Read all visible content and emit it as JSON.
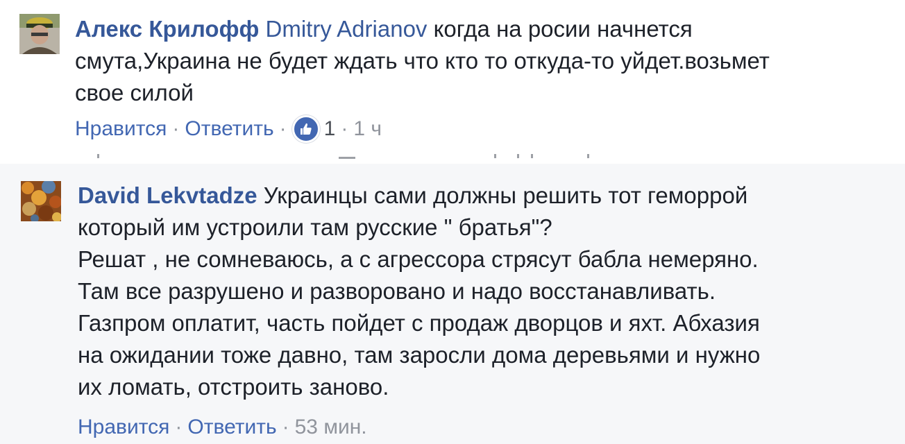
{
  "comments": [
    {
      "author": "Алекс Крилофф",
      "mention": "Dmitry Adrianov",
      "lines": [
        " когда на росии начнется",
        "смута,Украина не будет ждать что кто то откуда-то уйдет.возьмет",
        "свое силой"
      ],
      "like_label": "Нравится",
      "reply_label": "Ответить",
      "separator": "·",
      "reaction_count": "1",
      "timestamp": "1 ч",
      "reaction_icon": "thumbs-up-icon"
    },
    {
      "author": "David Lekvtadze",
      "lines": [
        " Украинцы сами должны решить тот геморрой",
        "который им устроили там русские \" братья\"?",
        "Решат , не сомневаюсь, а с агрессора стрясут бабла немеряно.",
        "Там все разрушено и разворовано и надо восстанавливать.",
        "Газпром оплатит, часть пойдет с продаж дворцов и яхт. Абхазия",
        "на ожидании тоже давно, там заросли дома деревьями и нужно",
        "их ломать, отстроить заново."
      ],
      "like_label": "Нравится",
      "reply_label": "Ответить",
      "separator": "·",
      "timestamp": "53 мин."
    }
  ],
  "colors": {
    "author": "#365899",
    "link": "#4267b2",
    "text": "#1d2129",
    "meta": "#90949c",
    "reply_background": "#f6f7f9",
    "like_badge": "#4267b2"
  }
}
